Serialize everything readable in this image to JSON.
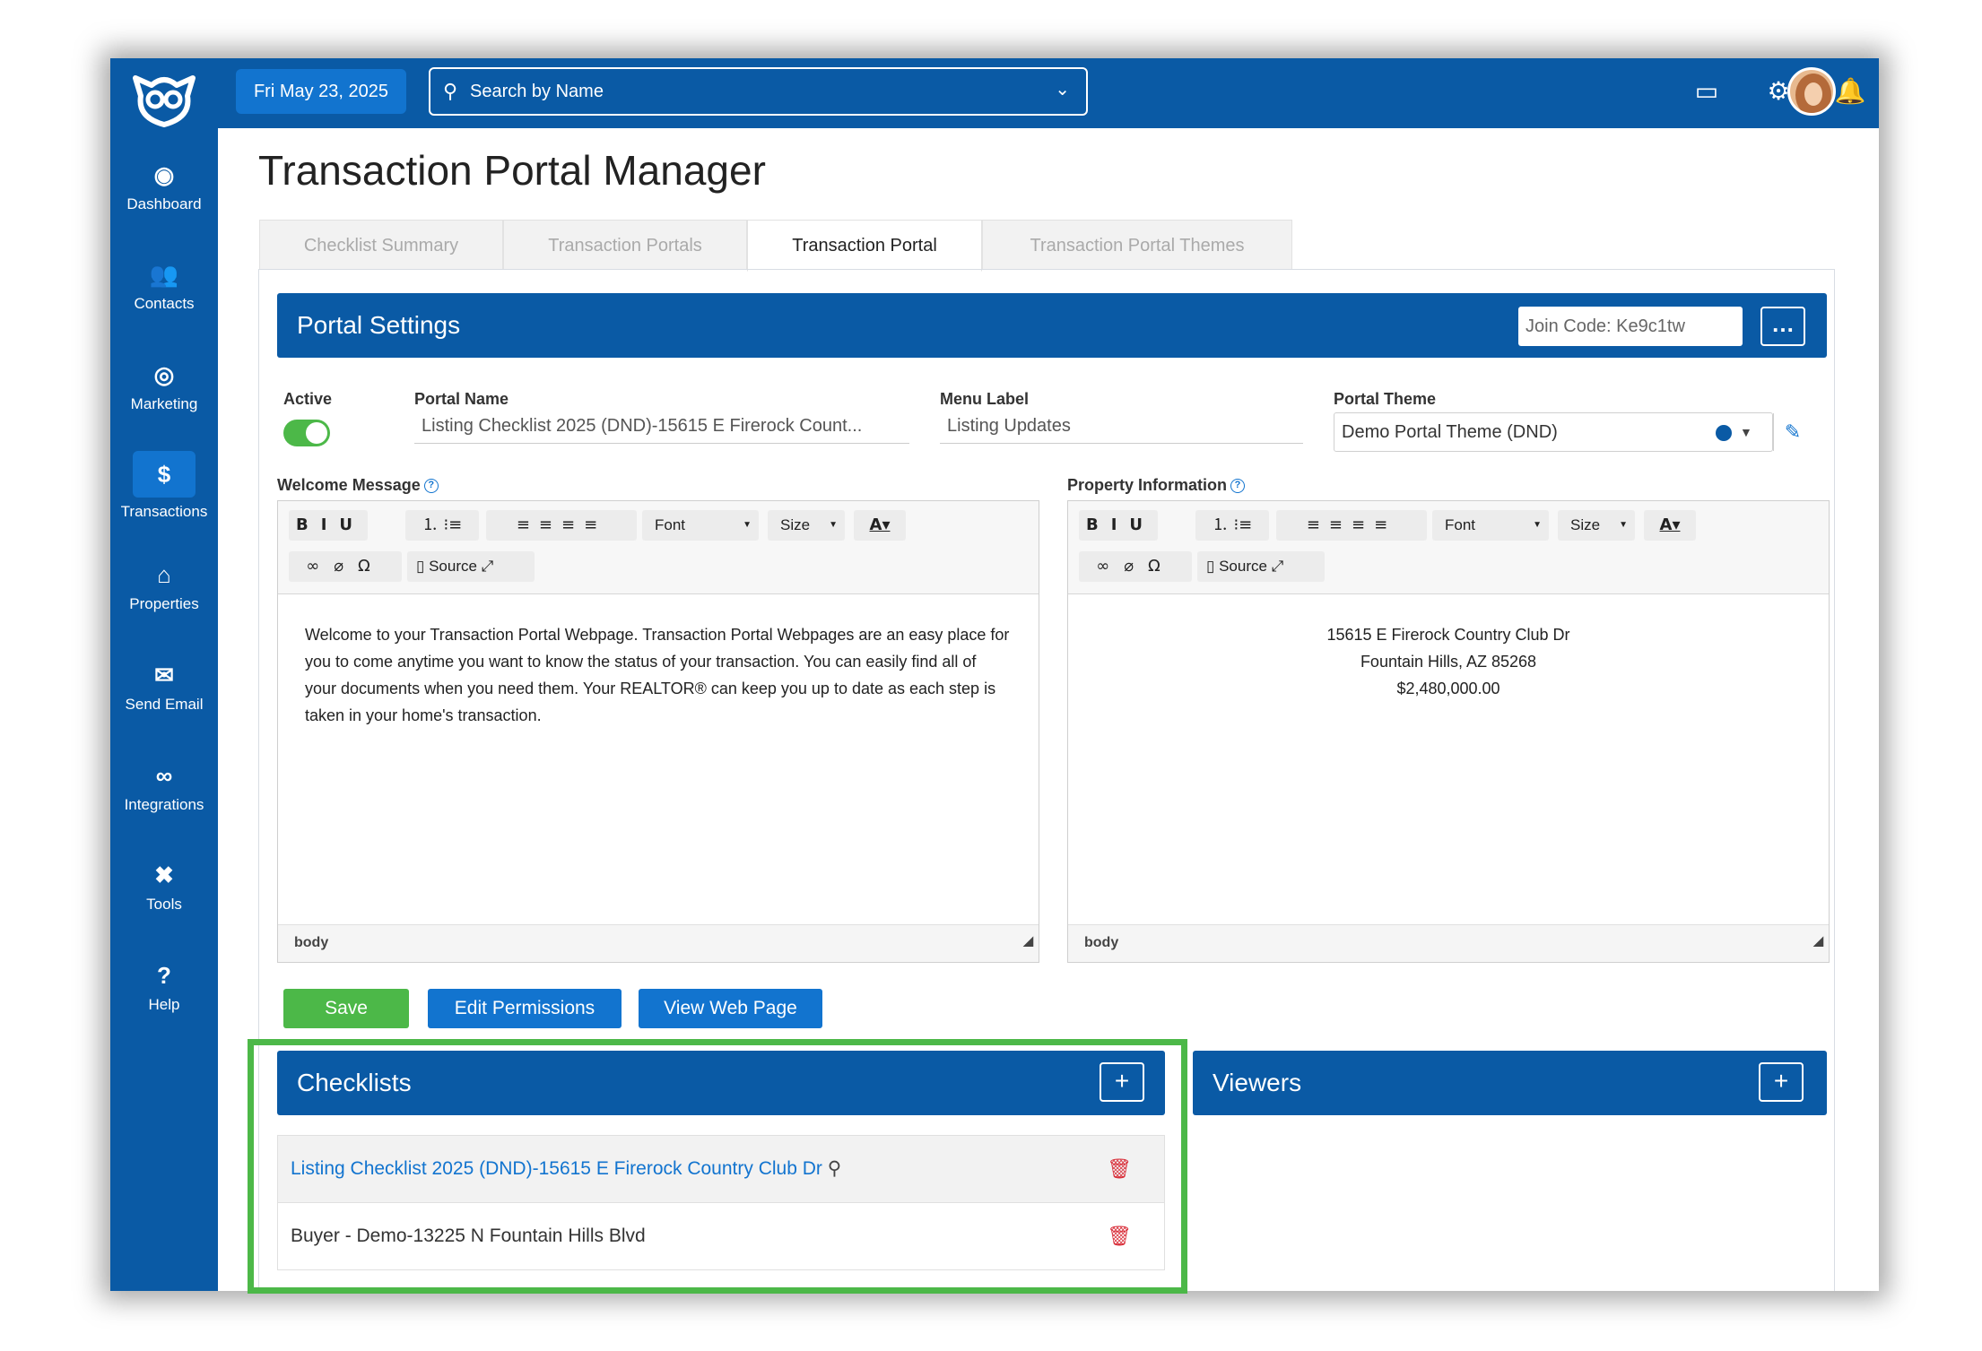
{
  "app": {
    "title": "Transaction Portal Manager"
  },
  "topbar": {
    "date": "Fri May 23, 2025",
    "search_placeholder": "Search by Name"
  },
  "sidebar": {
    "items": [
      {
        "label": "Dashboard",
        "icon": "dashboard-icon"
      },
      {
        "label": "Contacts",
        "icon": "contacts-icon"
      },
      {
        "label": "Marketing",
        "icon": "marketing-icon"
      },
      {
        "label": "Transactions",
        "icon": "dollar-icon",
        "active": true
      },
      {
        "label": "Properties",
        "icon": "home-icon"
      },
      {
        "label": "Send Email",
        "icon": "envelope-icon"
      },
      {
        "label": "Integrations",
        "icon": "link-icon"
      },
      {
        "label": "Tools",
        "icon": "tools-icon"
      },
      {
        "label": "Help",
        "icon": "help-icon"
      }
    ]
  },
  "tabs": [
    "Checklist Summary",
    "Transaction Portals",
    "Transaction Portal",
    "Transaction Portal Themes"
  ],
  "portal_settings": {
    "title": "Portal Settings",
    "join_code": "Join Code: Ke9c1tw",
    "active_label": "Active",
    "portal_name_label": "Portal Name",
    "portal_name": "Listing Checklist 2025 (DND)-15615 E Firerock Count...",
    "menu_label_label": "Menu Label",
    "menu_label": "Listing Updates",
    "portal_theme_label": "Portal Theme",
    "portal_theme": "Demo Portal Theme (DND)",
    "welcome_label": "Welcome Message",
    "property_label": "Property Information"
  },
  "editor": {
    "font": "Font",
    "size": "Size",
    "source": "Source",
    "footer": "body"
  },
  "welcome_text": "Welcome to your Transaction Portal Webpage. Transaction Portal Webpages are an easy place for you to come anytime you want to know the status of your transaction. You can easily find all of your documents when you need them. Your REALTOR® can keep you up to date as each step is taken in your home's transaction.",
  "property": {
    "line1": "15615 E Firerock Country Club Dr",
    "line2": "Fountain Hills, AZ 85268",
    "line3": "$2,480,000.00"
  },
  "buttons": {
    "save": "Save",
    "edit_permissions": "Edit Permissions",
    "view_web_page": "View Web Page"
  },
  "checklists": {
    "title": "Checklists",
    "items": [
      "Listing Checklist 2025 (DND)-15615 E Firerock Country Club Dr",
      "Buyer - Demo-13225 N Fountain Hills Blvd"
    ]
  },
  "viewers": {
    "title": "Viewers"
  },
  "colors": {
    "primary": "#0a5aa5",
    "accent": "#1274cf",
    "success": "#4cb848",
    "danger": "#d9303b"
  }
}
